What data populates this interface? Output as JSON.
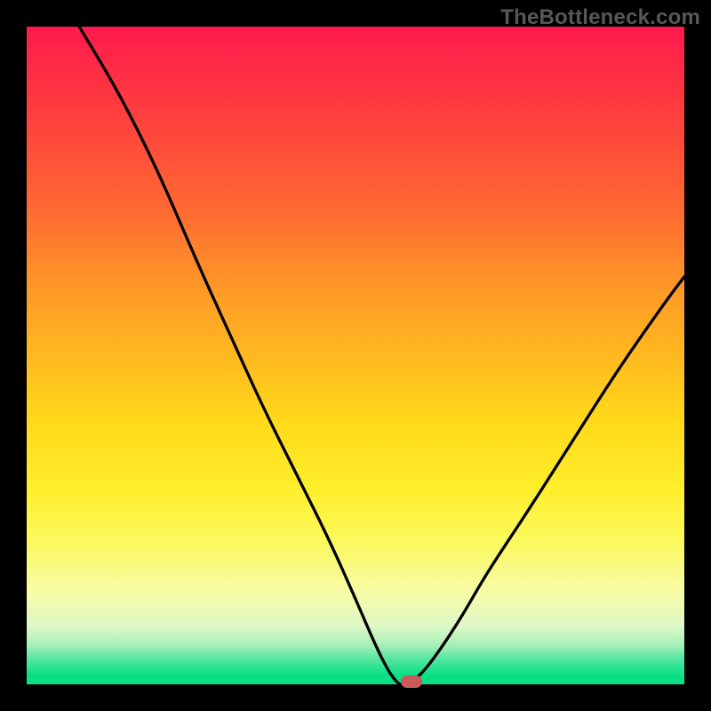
{
  "watermark": {
    "text": "TheBottleneck.com"
  },
  "chart_data": {
    "type": "line",
    "title": "",
    "xlabel": "",
    "ylabel": "",
    "x_range": [
      0,
      100
    ],
    "y_range": [
      0,
      100
    ],
    "series": [
      {
        "name": "bottleneck-curve",
        "x": [
          8,
          14,
          20,
          26,
          31,
          36,
          41,
          46,
          50,
          53,
          55,
          56.5,
          57.5,
          59.5,
          62,
          66,
          70,
          76,
          83,
          90,
          97,
          100
        ],
        "values": [
          100,
          90,
          78,
          64,
          53,
          42,
          32,
          22,
          13,
          6,
          2,
          0,
          0,
          1,
          4,
          10,
          17,
          26,
          37,
          48,
          58,
          62
        ]
      }
    ],
    "optimum_marker": {
      "x": 58.5,
      "y": 0
    },
    "background_gradient_meaning": "red=high bottleneck, green=no bottleneck"
  },
  "colors": {
    "curve_stroke": "#000000",
    "marker_fill": "#c85a5a"
  }
}
